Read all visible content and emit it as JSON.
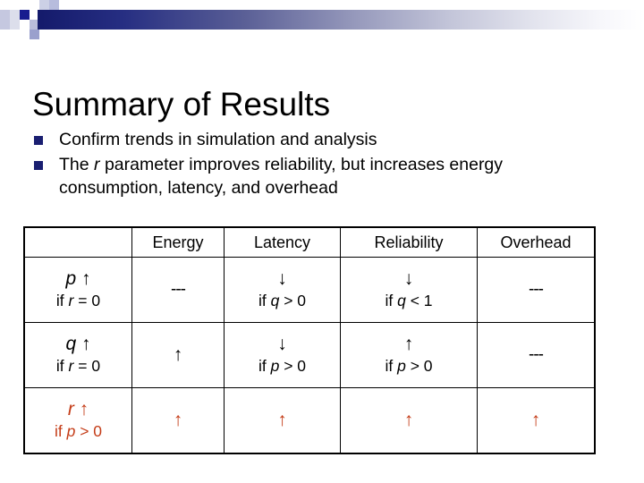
{
  "slide": {
    "title": "Summary of Results",
    "accent_dark": "#1a1f71",
    "accent_red": "#c43c17"
  },
  "banner": {
    "name": "decorative-banner"
  },
  "bullets": [
    {
      "text": "Confirm trends in simulation and analysis",
      "parts": [
        {
          "t": "Confirm trends in simulation and analysis",
          "i": false
        }
      ]
    },
    {
      "text": "The r parameter improves reliability, but increases energy consumption, latency, and overhead",
      "parts": [
        {
          "t": "The ",
          "i": false
        },
        {
          "t": "r",
          "i": true
        },
        {
          "t": " parameter improves reliability, but increases energy consumption, latency, and overhead",
          "i": false
        }
      ]
    }
  ],
  "table": {
    "headers": [
      "",
      "Energy",
      "Latency",
      "Reliability",
      "Overhead"
    ],
    "rows": [
      {
        "highlight": false,
        "label": {
          "sym": "p",
          "arrow": "↑",
          "cond_pre": "if ",
          "cond_sym": "r",
          "cond_post": " = 0"
        },
        "cells": [
          {
            "arrow": "---",
            "cond": ""
          },
          {
            "arrow": "↓",
            "cond_pre": "if ",
            "cond_sym": "q",
            "cond_post": " > 0"
          },
          {
            "arrow": "↓",
            "cond_pre": "if ",
            "cond_sym": "q",
            "cond_post": " < 1"
          },
          {
            "arrow": "---",
            "cond": ""
          }
        ]
      },
      {
        "highlight": false,
        "label": {
          "sym": "q",
          "arrow": "↑",
          "cond_pre": "if ",
          "cond_sym": "r",
          "cond_post": " = 0"
        },
        "cells": [
          {
            "arrow": "↑",
            "cond": ""
          },
          {
            "arrow": "↓",
            "cond_pre": "if ",
            "cond_sym": "p",
            "cond_post": " > 0"
          },
          {
            "arrow": "↑",
            "cond_pre": "if ",
            "cond_sym": "p",
            "cond_post": " > 0"
          },
          {
            "arrow": "---",
            "cond": ""
          }
        ]
      },
      {
        "highlight": true,
        "label": {
          "sym": "r",
          "arrow": "↑",
          "cond_pre": "if ",
          "cond_sym": "p",
          "cond_post": " > 0"
        },
        "cells": [
          {
            "arrow": "↑",
            "cond": ""
          },
          {
            "arrow": "↑",
            "cond": ""
          },
          {
            "arrow": "↑",
            "cond": ""
          },
          {
            "arrow": "↑",
            "cond": ""
          }
        ]
      }
    ]
  }
}
